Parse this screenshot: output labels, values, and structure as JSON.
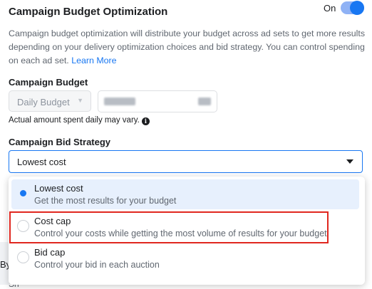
{
  "header": {
    "title": "Campaign Budget Optimization",
    "toggle_label": "On",
    "toggle_on": true
  },
  "description": {
    "text": "Campaign budget optimization will distribute your budget across ad sets to get more results depending on your delivery optimization choices and bid strategy. You can control spending on each ad set.",
    "link": "Learn More"
  },
  "budget": {
    "label": "Campaign Budget",
    "type_value": "Daily Budget",
    "note": "Actual amount spent daily may vary."
  },
  "bid_strategy": {
    "label": "Campaign Bid Strategy",
    "value": "Lowest cost",
    "options": [
      {
        "title": "Lowest cost",
        "subtitle": "Get the most results for your budget",
        "selected": true
      },
      {
        "title": "Cost cap",
        "subtitle": "Control your costs while getting the most volume of results for your budget",
        "selected": false
      },
      {
        "title": "Bid cap",
        "subtitle": "Control your bid in each auction",
        "selected": false
      }
    ]
  },
  "background": {
    "partial_text": "By",
    "partial_text2": "Sh"
  },
  "colors": {
    "accent": "#1877f2",
    "highlight": "#e0271f"
  }
}
